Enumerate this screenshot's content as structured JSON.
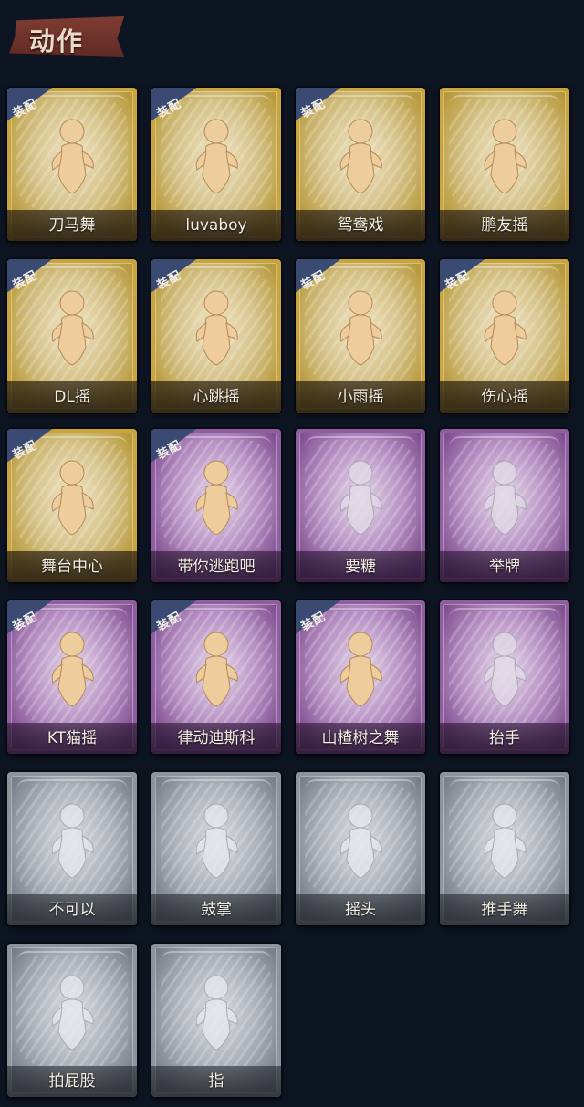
{
  "header": {
    "title": "动作"
  },
  "equipped_label": "装配",
  "colors": {
    "gold": "#c9a43a",
    "purple": "#8e5ea0",
    "gray": "#8d939c",
    "background": "#0e1522"
  },
  "actions": [
    {
      "name": "刀马舞",
      "tier": "gold",
      "equipped": true,
      "icon": "dance-figure-icon",
      "figure": "gold"
    },
    {
      "name": "luvaboy",
      "tier": "gold",
      "equipped": true,
      "icon": "dance-figure-icon",
      "figure": "gold"
    },
    {
      "name": "鸳鸯戏",
      "tier": "gold",
      "equipped": true,
      "icon": "dance-figure-icon",
      "figure": "gold"
    },
    {
      "name": "鹏友摇",
      "tier": "gold",
      "equipped": false,
      "icon": "dance-figure-icon",
      "figure": "gold"
    },
    {
      "name": "DL摇",
      "tier": "gold",
      "equipped": true,
      "icon": "dance-figure-icon",
      "figure": "gold"
    },
    {
      "name": "心跳摇",
      "tier": "gold",
      "equipped": true,
      "icon": "dance-figure-icon",
      "figure": "gold"
    },
    {
      "name": "小雨摇",
      "tier": "gold",
      "equipped": true,
      "icon": "dance-figure-icon",
      "figure": "gold"
    },
    {
      "name": "伤心摇",
      "tier": "gold",
      "equipped": true,
      "icon": "heart-hands-figure-icon",
      "figure": "gold"
    },
    {
      "name": "舞台中心",
      "tier": "gold",
      "equipped": true,
      "icon": "dance-figure-icon",
      "figure": "gold"
    },
    {
      "name": "带你逃跑吧",
      "tier": "purple",
      "equipped": true,
      "icon": "dance-figure-icon",
      "figure": "gold"
    },
    {
      "name": "要糖",
      "tier": "purple",
      "equipped": false,
      "icon": "ghost-figure-icon",
      "figure": "ghost"
    },
    {
      "name": "举牌",
      "tier": "purple",
      "equipped": false,
      "icon": "sign-figure-icon",
      "figure": "ghost"
    },
    {
      "name": "KT猫摇",
      "tier": "purple",
      "equipped": true,
      "icon": "dance-figure-icon",
      "figure": "gold"
    },
    {
      "name": "律动迪斯科",
      "tier": "purple",
      "equipped": true,
      "icon": "dance-figure-icon",
      "figure": "gold"
    },
    {
      "name": "山楂树之舞",
      "tier": "purple",
      "equipped": true,
      "icon": "dance-figure-icon",
      "figure": "gold"
    },
    {
      "name": "抬手",
      "tier": "purple",
      "equipped": false,
      "icon": "ghost-figure-icon",
      "figure": "ghost"
    },
    {
      "name": "不可以",
      "tier": "gray",
      "equipped": false,
      "icon": "finger-wag-icon",
      "figure": "ghost"
    },
    {
      "name": "鼓掌",
      "tier": "gray",
      "equipped": false,
      "icon": "clapping-hands-icon",
      "figure": "ghost"
    },
    {
      "name": "摇头",
      "tier": "gray",
      "equipped": false,
      "icon": "ghost-figure-icon",
      "figure": "ghost"
    },
    {
      "name": "推手舞",
      "tier": "gray",
      "equipped": false,
      "icon": "ghost-figure-icon",
      "figure": "ghost"
    },
    {
      "name": "拍屁股",
      "tier": "gray",
      "equipped": false,
      "icon": "ghost-figure-icon",
      "figure": "ghost"
    },
    {
      "name": "指",
      "tier": "gray",
      "equipped": false,
      "icon": "pointing-hand-icon",
      "figure": "ghost"
    }
  ]
}
